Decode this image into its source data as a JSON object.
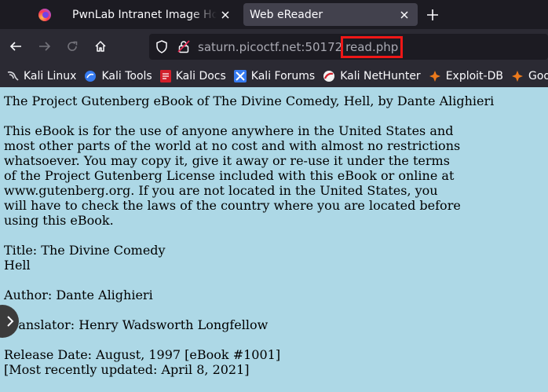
{
  "browser": {
    "tabs": [
      {
        "title": "PwnLab Intranet Image Hosti",
        "active": false
      },
      {
        "title": "Web eReader",
        "active": true
      }
    ],
    "url": {
      "host": "saturn.picoctf.net",
      "port": ":50172",
      "path": "read.php",
      "highlight_color": "#ef1717"
    },
    "bookmarks": [
      {
        "label": "Kali Linux",
        "icon": "kali-dragon-icon"
      },
      {
        "label": "Kali Tools",
        "icon": "kali-tools-icon"
      },
      {
        "label": "Kali Docs",
        "icon": "kali-docs-icon"
      },
      {
        "label": "Kali Forums",
        "icon": "kali-forums-icon"
      },
      {
        "label": "Kali NetHunter",
        "icon": "kali-nethunter-icon"
      },
      {
        "label": "Exploit-DB",
        "icon": "exploit-db-icon"
      },
      {
        "label": "Google",
        "icon": "google-hacking-db-icon"
      }
    ],
    "colors": {
      "tabbar": "#1c1b22",
      "toolbar": "#2b2a33",
      "active_tab": "#42414d"
    }
  },
  "page": {
    "background": "#add8e6",
    "lines": [
      "The Project Gutenberg eBook of The Divine Comedy, Hell, by Dante Alighieri",
      "This eBook is for the use of anyone anywhere in the United States and\nmost other parts of the world at no cost and with almost no restrictions\nwhatsoever. You may copy it, give it away or re-use it under the terms\nof the Project Gutenberg License included with this eBook or online at\nwww.gutenberg.org. If you are not located in the United States, you\nwill have to check the laws of the country where you are located before\nusing this eBook.",
      "Title: The Divine Comedy\nHell",
      "Author: Dante Alighieri",
      "Translator: Henry Wadsworth Longfellow",
      "Release Date: August, 1997 [eBook #1001]\n[Most recently updated: April 8, 2021]"
    ]
  }
}
